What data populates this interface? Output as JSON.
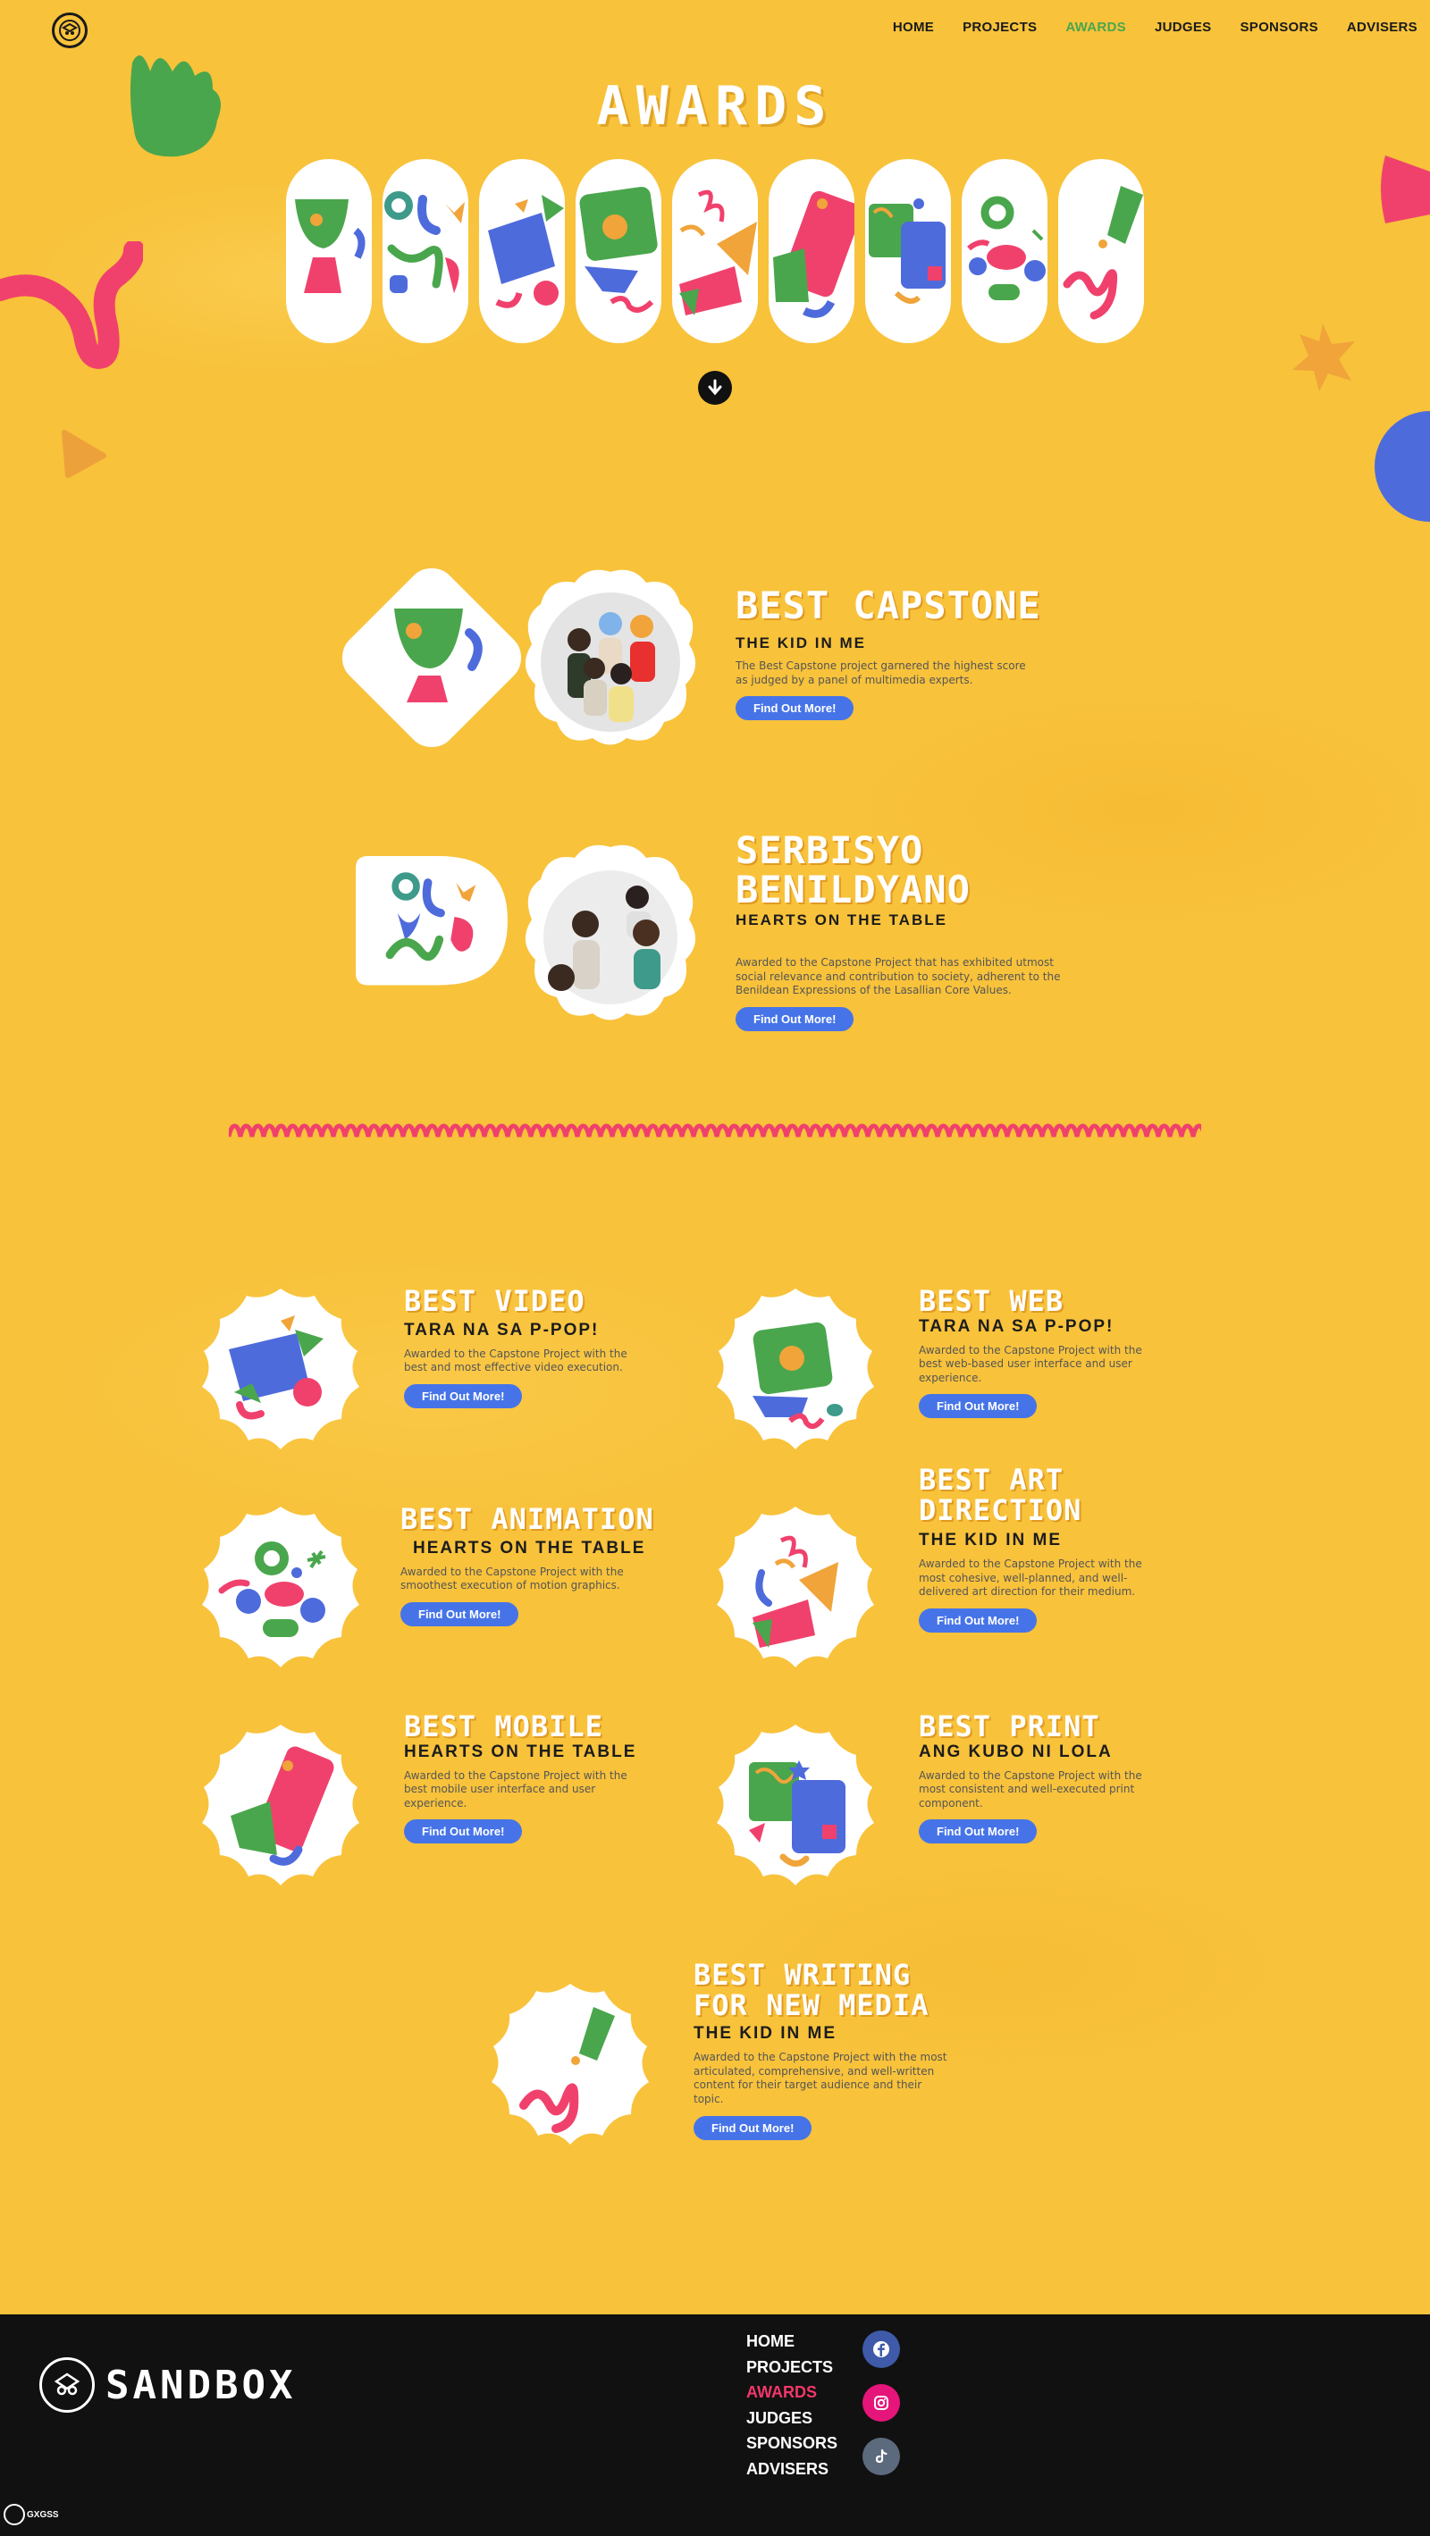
{
  "nav": {
    "items": [
      "HOME",
      "PROJECTS",
      "AWARDS",
      "JUDGES",
      "SPONSORS",
      "ADVISERS"
    ],
    "active": "AWARDS"
  },
  "page": {
    "title": "AWARDS"
  },
  "featured": [
    {
      "title": "BEST CAPSTONE",
      "project": "THE KID IN ME",
      "description": "The Best Capstone project garnered the highest score as judged by a panel of multimedia experts.",
      "button": "Find Out More!"
    },
    {
      "title": "SERBISYO BENILDYANO",
      "project": "HEARTS ON THE TABLE",
      "description": "Awarded to the Capstone Project that has exhibited utmost social relevance and contribution to society, adherent to the Benildean Expressions of the Lasallian Core Values.",
      "button": "Find Out More!"
    }
  ],
  "awards": [
    {
      "title": "BEST VIDEO",
      "project": "TARA NA SA P-POP!",
      "description": "Awarded to the Capstone Project with the best and most effective video execution.",
      "button": "Find Out More!"
    },
    {
      "title": "BEST WEB",
      "project": "TARA NA SA P-POP!",
      "description": "Awarded to the Capstone Project with the best web-based user interface and user experience.",
      "button": "Find Out More!"
    },
    {
      "title": "BEST ANIMATION",
      "project": "HEARTS ON THE TABLE",
      "description": "Awarded to the Capstone Project with the smoothest execution of motion graphics.",
      "button": "Find Out More!"
    },
    {
      "title": "BEST ART DIRECTION",
      "project": "THE KID IN ME",
      "description": "Awarded to the Capstone Project with the most cohesive, well-planned, and well-delivered art direction for their medium.",
      "button": "Find Out More!"
    },
    {
      "title": "BEST MOBILE",
      "project": "HEARTS ON THE TABLE",
      "description": "Awarded to the Capstone Project with the best mobile user interface and user experience.",
      "button": "Find Out More!"
    },
    {
      "title": "BEST PRINT",
      "project": "ANG KUBO NI LOLA",
      "description": "Awarded to the Capstone Project with the most consistent and well-executed print component.",
      "button": "Find Out More!"
    },
    {
      "title": "BEST WRITING FOR NEW MEDIA",
      "project": "THE KID IN ME",
      "description": "Awarded to the Capstone Project with the most articulated, comprehensive, and well-written content for their target audience and their topic.",
      "button": "Find Out More!"
    }
  ],
  "footer": {
    "brand": "SANDBOX",
    "links": [
      "HOME",
      "PROJECTS",
      "AWARDS",
      "JUDGES",
      "SPONSORS",
      "ADVISERS"
    ],
    "active": "AWARDS",
    "social": [
      "facebook-icon",
      "instagram-icon",
      "tiktok-icon"
    ],
    "corner_text": "GXGSS"
  },
  "colors": {
    "background": "#f8c23b",
    "accent_green": "#4aa64c",
    "button_blue": "#4674e8",
    "pink": "#f2376a",
    "footer": "#111111"
  }
}
